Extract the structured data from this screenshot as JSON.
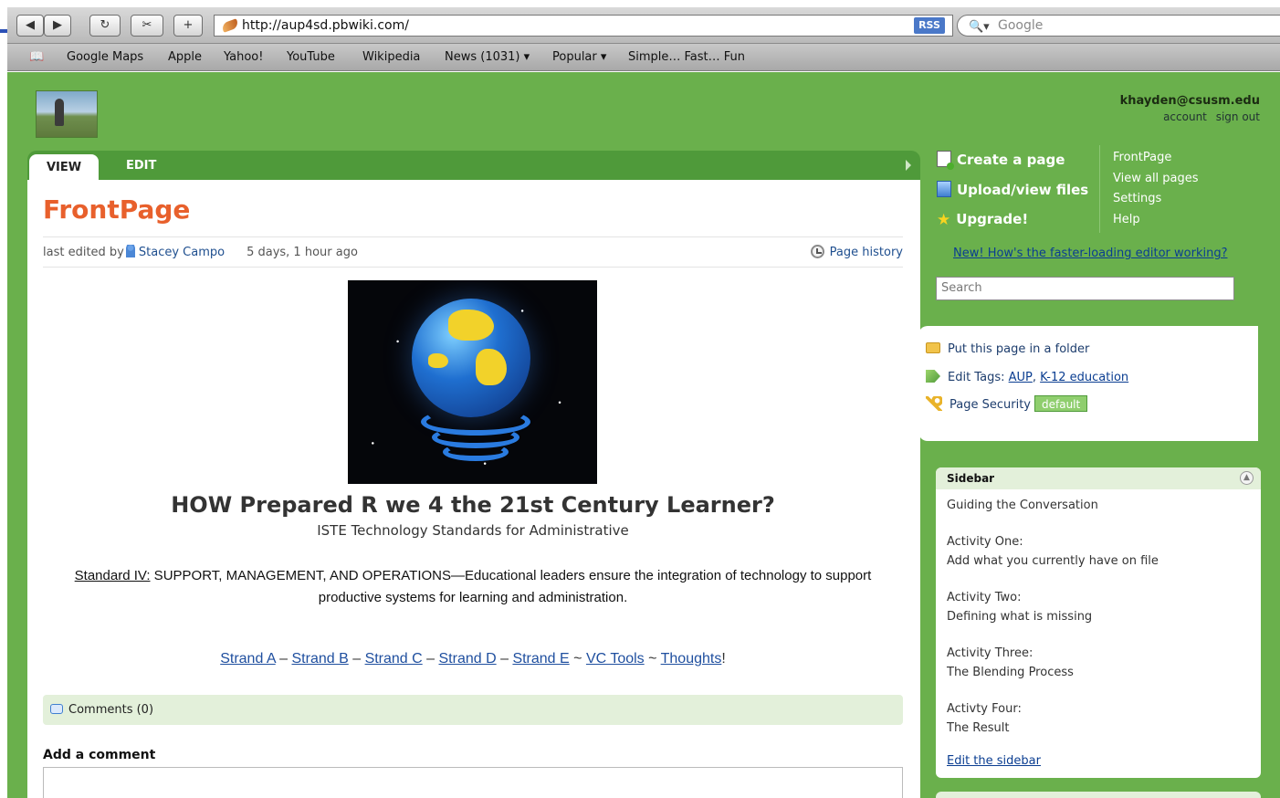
{
  "browser": {
    "url": "http://aup4sd.pbwiki.com/",
    "rss_label": "RSS",
    "search_placeholder": "Google",
    "nav": {
      "back": "◀",
      "forward": "▶",
      "reload": "↻",
      "clip": "✂",
      "add": "+"
    },
    "bookmarks": [
      "Google Maps",
      "Apple",
      "Yahoo!",
      "YouTube",
      "Wikipedia",
      "News (1031) ▾",
      "Popular ▾",
      "Simple… Fast… Fun"
    ]
  },
  "user": {
    "email": "khayden@csusm.edu",
    "account": "account",
    "sign_out": "sign out"
  },
  "tabs": {
    "view": "VIEW",
    "edit": "EDIT"
  },
  "page": {
    "title": "FrontPage",
    "meta_prefix": "last edited by",
    "author": "Stacey Campo",
    "ago": "5 days, 1 hour ago",
    "history": "Page history",
    "headline": "HOW Prepared R we 4 the 21st Century Learner?",
    "subhead": "ISTE Technology Standards for Administrative",
    "standard_label": "Standard IV:",
    "standard_line1": " SUPPORT, MANAGEMENT, AND OPERATIONS—Educational leaders ensure the integration of technology to support",
    "standard_line2": "productive systems for learning and administration.",
    "strands": {
      "a": "Strand A",
      "b": "Strand B",
      "c": "Strand C",
      "d": "Strand D",
      "e": "Strand E",
      "vc": "VC Tools",
      "thoughts": "Thoughts",
      "sep_dash": " – ",
      "sep_tilde": " ~ ",
      "end": "!"
    },
    "comments_label": "Comments (0)",
    "add_comment": "Add a comment"
  },
  "actions": {
    "create": "Create a page",
    "upload": "Upload/view files",
    "upgrade": "Upgrade!"
  },
  "quick_links": [
    "FrontPage",
    "View all pages",
    "Settings",
    "Help"
  ],
  "feedback_link": "New! How's the faster-loading editor working?",
  "search_placeholder": "Search",
  "page_tools": {
    "folder": "Put this page in a folder",
    "tags_label": "Edit Tags:",
    "tag1": "AUP",
    "tag2": "K-12 education",
    "security": "Page Security",
    "security_badge": "default"
  },
  "sidebar": {
    "title": "Sidebar",
    "items": [
      "Guiding the Conversation",
      "Activity One:",
      "Add what you currently have on file",
      "Activity Two:",
      "Defining what is missing",
      "Activity Three:",
      "The Blending Process",
      "Activty Four:",
      "The Result"
    ],
    "edit": "Edit the sidebar"
  },
  "colors": {
    "page_green": "#6ab04c",
    "tab_green": "#4f9a3a",
    "title_orange": "#e8602c",
    "link_blue": "#1f4f9f"
  }
}
